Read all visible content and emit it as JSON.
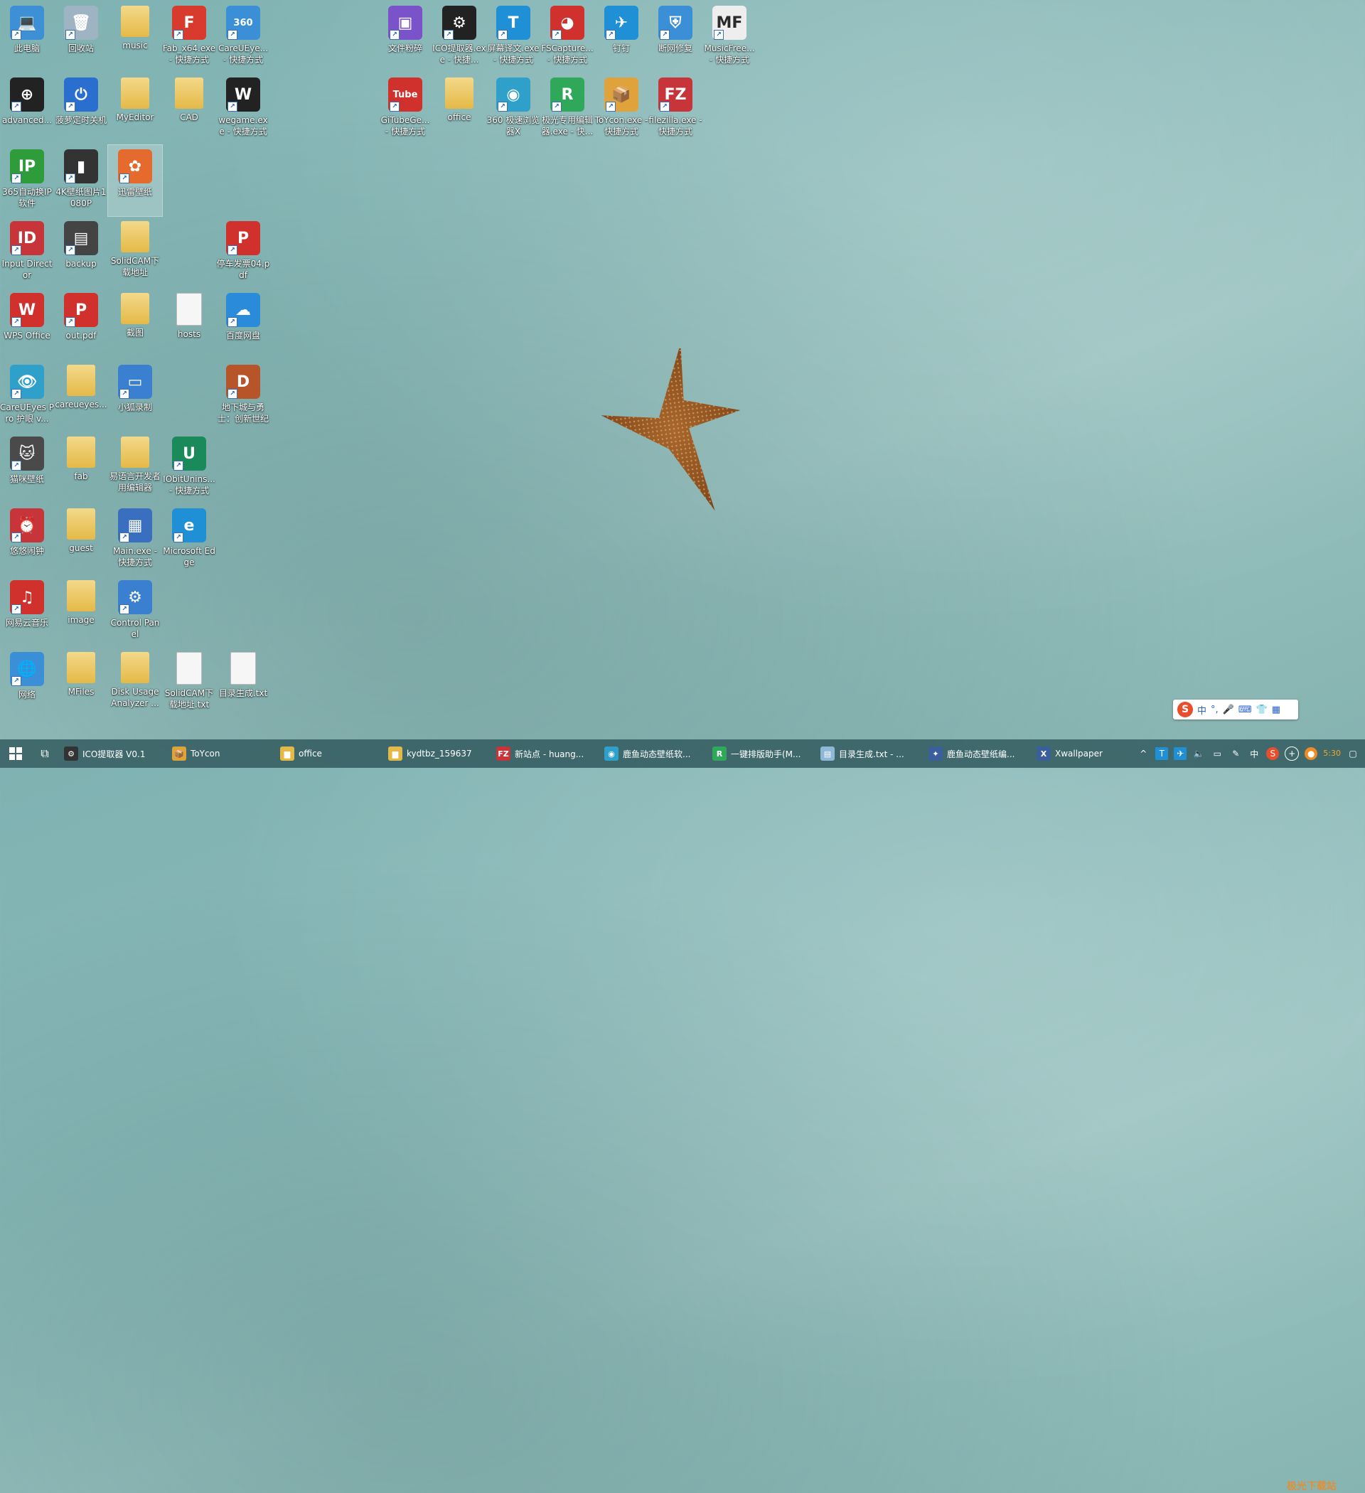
{
  "desktop": {
    "icons": [
      {
        "label": "此电脑",
        "glyph": "💻",
        "color": "#3d8fd6"
      },
      {
        "label": "回收站",
        "glyph": "🗑",
        "color": "#9fb4c2"
      },
      {
        "label": "music",
        "glyph": "",
        "color": "folder"
      },
      {
        "label": "Fab_x64.exe - 快捷方式",
        "glyph": "F",
        "color": "#d83a2e"
      },
      {
        "label": "CareUEye... - 快捷方式",
        "glyph": "360",
        "color": "#3a8fd6"
      },
      {
        "label": "advanced...",
        "glyph": "⊕",
        "color": "#222222"
      },
      {
        "label": "菠萝定时关机",
        "glyph": "⏻",
        "color": "#2a6fd0"
      },
      {
        "label": "MyEditor",
        "glyph": "",
        "color": "folder"
      },
      {
        "label": "CAD",
        "glyph": "",
        "color": "folder"
      },
      {
        "label": "wegame.exe - 快捷方式",
        "glyph": "W",
        "color": "#222222"
      },
      {
        "label": "365自动换IP软件",
        "glyph": "IP",
        "color": "#2e9c3a"
      },
      {
        "label": "4K壁纸图片1080P",
        "glyph": "▮",
        "color": "#333333"
      },
      {
        "label": "迅雷壁纸",
        "glyph": "✿",
        "color": "#e46a2e"
      },
      {
        "label": "Input Director",
        "glyph": "ID",
        "color": "#c7353a"
      },
      {
        "label": "backup",
        "glyph": "▤",
        "color": "#444444"
      },
      {
        "label": "SolidCAM下载地址",
        "glyph": "",
        "color": "folder"
      },
      {
        "label": "停车发票04.pdf",
        "glyph": "P",
        "color": "#d0312d"
      },
      {
        "label": "WPS Office",
        "glyph": "W",
        "color": "#d0312d"
      },
      {
        "label": "out.pdf",
        "glyph": "P",
        "color": "#d0312d"
      },
      {
        "label": "截图",
        "glyph": "",
        "color": "folder"
      },
      {
        "label": "hosts",
        "glyph": "",
        "color": "file"
      },
      {
        "label": "百度网盘",
        "glyph": "☁",
        "color": "#2a8bdb"
      },
      {
        "label": "CareUEyes Pro 护眼 v...",
        "glyph": "👁",
        "color": "#2ea0c9"
      },
      {
        "label": "careueyes...",
        "glyph": "",
        "color": "folder"
      },
      {
        "label": "小狐录制",
        "glyph": "▭",
        "color": "#3a7fd0"
      },
      {
        "label": "地下城与勇士：创新世纪",
        "glyph": "D",
        "color": "#b8542a"
      },
      {
        "label": "猫咪壁纸",
        "glyph": "🐱",
        "color": "#4a4a4a"
      },
      {
        "label": "fab",
        "glyph": "",
        "color": "folder"
      },
      {
        "label": "易语言开发者用编辑器",
        "glyph": "",
        "color": "folder"
      },
      {
        "label": "IObitUnins... - 快捷方式",
        "glyph": "U",
        "color": "#1a8a5a"
      },
      {
        "label": "悠悠闹钟",
        "glyph": "⏰",
        "color": "#c7353a"
      },
      {
        "label": "guest",
        "glyph": "",
        "color": "folder"
      },
      {
        "label": "Main.exe - 快捷方式",
        "glyph": "▦",
        "color": "#3a6fc0"
      },
      {
        "label": "Microsoft Edge",
        "glyph": "e",
        "color": "#1f8fd6"
      },
      {
        "label": "网易云音乐",
        "glyph": "♫",
        "color": "#d0312d"
      },
      {
        "label": "image",
        "glyph": "",
        "color": "folder"
      },
      {
        "label": "Control Panel",
        "glyph": "⚙",
        "color": "#3a7fd0"
      },
      {
        "label": "网络",
        "glyph": "🌐",
        "color": "#3a8fd6"
      },
      {
        "label": "MFiles",
        "glyph": "",
        "color": "folder"
      },
      {
        "label": "Disk Usage Analyzer ...",
        "glyph": "",
        "color": "folder"
      },
      {
        "label": "SolidCAM下载地址.txt",
        "glyph": "",
        "color": "file"
      },
      {
        "label": "目录生成.txt",
        "glyph": "",
        "color": "file"
      },
      {
        "label": "文件粉碎",
        "glyph": "▣",
        "color": "#7a52c9"
      },
      {
        "label": "ICO提取器.exe - 快捷...",
        "glyph": "⚙",
        "color": "#222222"
      },
      {
        "label": "屏幕译文.exe - 快捷方式",
        "glyph": "T",
        "color": "#1f8fd6"
      },
      {
        "label": "FSCapture... - 快捷方式",
        "glyph": "◕",
        "color": "#d0312d"
      },
      {
        "label": "钉钉",
        "glyph": "✈",
        "color": "#1f8fd6"
      },
      {
        "label": "断网修复",
        "glyph": "⛨",
        "color": "#3a8fd6"
      },
      {
        "label": "MusicFree... - 快捷方式",
        "glyph": "MF",
        "color": "#eeeeee"
      },
      {
        "label": "GiTubeGe... - 快捷方式",
        "glyph": "Tube",
        "color": "#d0312d"
      },
      {
        "label": "office",
        "glyph": "",
        "color": "folder"
      },
      {
        "label": "360 极速浏览器X",
        "glyph": "◉",
        "color": "#2ea0c9"
      },
      {
        "label": "极光专用编辑器.exe - 快...",
        "glyph": "R",
        "color": "#2fa85a"
      },
      {
        "label": "ToYcon.exe - 快捷方式",
        "glyph": "📦",
        "color": "#e0a23a"
      },
      {
        "label": "filezilla.exe - 快捷方式",
        "glyph": "FZ",
        "color": "#c7353a"
      }
    ]
  },
  "ime": {
    "logo": "S",
    "mode": "中",
    "punct": "°,",
    "mic": "🎤",
    "kbd": "⌨",
    "shirt": "👕",
    "grid": "▦"
  },
  "taskbar": {
    "items": [
      {
        "label": "ICO提取器 V0.1",
        "icon": "⚙",
        "color": "#333333"
      },
      {
        "label": "ToYcon",
        "icon": "📦",
        "color": "#e0a23a"
      },
      {
        "label": "office",
        "icon": "▆",
        "color": "#e5b947"
      },
      {
        "label": "kydtbz_159637",
        "icon": "▆",
        "color": "#e5b947"
      },
      {
        "label": "新站点 - huang...",
        "icon": "FZ",
        "color": "#c7353a"
      },
      {
        "label": "鹿鱼动态壁纸软...",
        "icon": "◉",
        "color": "#2ea0c9"
      },
      {
        "label": "一键排版助手(M...",
        "icon": "R",
        "color": "#2fa85a"
      },
      {
        "label": "目录生成.txt - ...",
        "icon": "▤",
        "color": "#8fb8d8"
      },
      {
        "label": "鹿鱼动态壁纸编...",
        "icon": "✦",
        "color": "#3a5f9a"
      },
      {
        "label": "Xwallpaper",
        "icon": "X",
        "color": "#3a5f9a"
      }
    ],
    "tray": {
      "chevron": "^",
      "time": "5:30",
      "lang": "中"
    },
    "watermark": "极光下载站"
  }
}
